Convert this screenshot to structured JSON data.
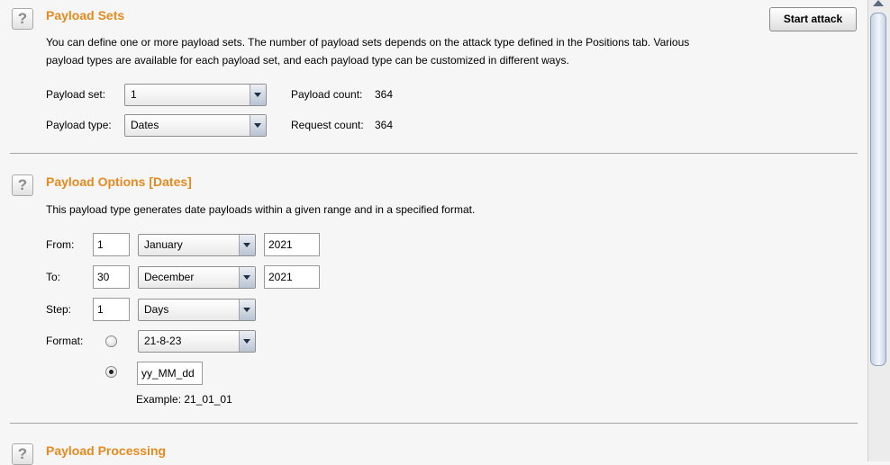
{
  "payload_sets": {
    "title": "Payload Sets",
    "description_line1": "You can define one or more payload sets. The number of payload sets depends on the attack type defined in the Positions tab. Various",
    "description_line2": "payload types are available for each payload set, and each payload type can be customized in different ways.",
    "payload_set_label": "Payload set:",
    "payload_set_value": "1",
    "payload_type_label": "Payload type:",
    "payload_type_value": "Dates",
    "payload_count_label": "Payload count:",
    "payload_count_value": "364",
    "request_count_label": "Request count:",
    "request_count_value": "364",
    "start_attack_label": "Start attack"
  },
  "payload_options": {
    "title": "Payload Options [Dates]",
    "description": "This payload type generates date payloads within a given range and in a specified format.",
    "from_label": "From:",
    "from_day": "1",
    "from_month": "January",
    "from_year": "2021",
    "to_label": "To:",
    "to_day": "30",
    "to_month": "December",
    "to_year": "2021",
    "step_label": "Step:",
    "step_value": "1",
    "step_unit": "Days",
    "format_label": "Format:",
    "format_preset": "21-8-23",
    "format_custom": "yy_MM_dd",
    "format_custom_selected": true,
    "example_label": "Example:",
    "example_value": "21_01_01"
  },
  "payload_processing": {
    "title": "Payload Processing"
  },
  "icons": {
    "help": "?"
  }
}
